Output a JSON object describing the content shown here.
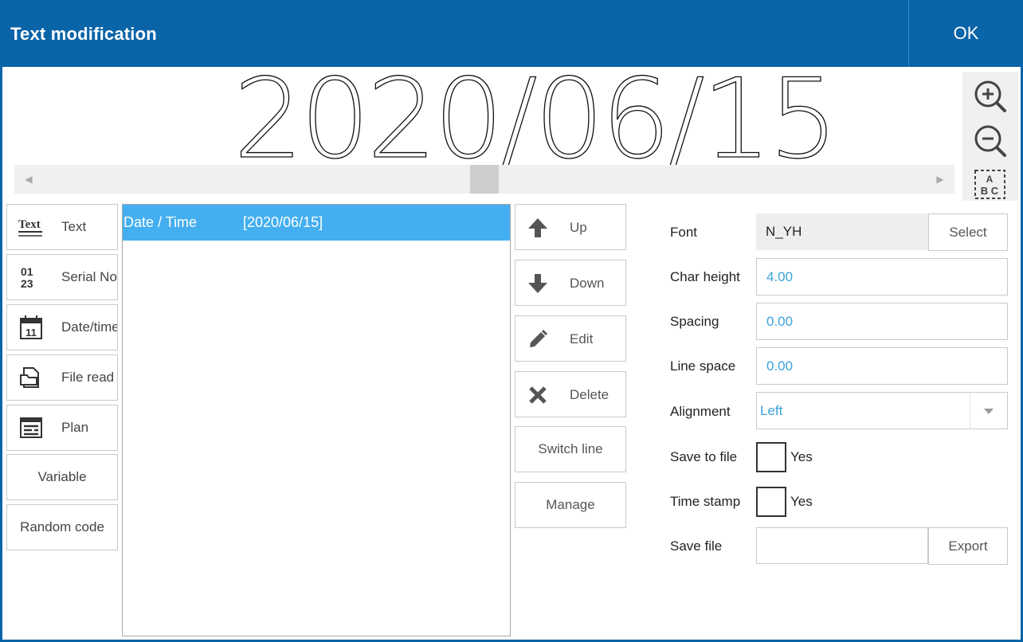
{
  "window": {
    "title": "Text modification",
    "ok_label": "OK"
  },
  "preview": {
    "text": "2020/06/15"
  },
  "zoom": {
    "zoom_in": "zoom-in-icon",
    "zoom_out": "zoom-out-icon",
    "fit": "abc-fit-icon",
    "fit_glyph_a": "A",
    "fit_glyph_bc": "B C"
  },
  "left_buttons": [
    {
      "label": "Text",
      "icon": "text-icon",
      "icon_text": "Text"
    },
    {
      "label": "Serial No.",
      "icon": "serial-icon",
      "icon_text_top": "01",
      "icon_text_bottom": "23"
    },
    {
      "label": "Date/time",
      "icon": "calendar-icon",
      "icon_text": "11"
    },
    {
      "label": "File read",
      "icon": "file-icon"
    },
    {
      "label": "Plan",
      "icon": "plan-icon"
    },
    {
      "label": "Variable"
    },
    {
      "label": "Random code"
    }
  ],
  "list": {
    "items": [
      {
        "name": "Date / Time",
        "value": "[2020/06/15]"
      }
    ]
  },
  "actions": [
    {
      "label": "Up",
      "icon": "arrow-up-icon"
    },
    {
      "label": "Down",
      "icon": "arrow-down-icon"
    },
    {
      "label": "Edit",
      "icon": "pencil-icon"
    },
    {
      "label": "Delete",
      "icon": "x-icon"
    },
    {
      "label": "Switch line"
    },
    {
      "label": "Manage"
    }
  ],
  "properties": {
    "font": {
      "label": "Font",
      "value": "N_YH",
      "button": "Select"
    },
    "char_height": {
      "label": "Char height",
      "value": "4.00"
    },
    "spacing": {
      "label": "Spacing",
      "value": "0.00"
    },
    "line_space": {
      "label": "Line space",
      "value": "0.00"
    },
    "alignment": {
      "label": "Alignment",
      "value": "Left"
    },
    "save_to_file": {
      "label": "Save to file",
      "option": "Yes",
      "checked": false
    },
    "time_stamp": {
      "label": "Time stamp",
      "option": "Yes",
      "checked": false
    },
    "save_file": {
      "label": "Save file",
      "value": "",
      "button": "Export"
    }
  },
  "colors": {
    "titlebar": "#0a64a8",
    "selection": "#43aef0",
    "value_text": "#3aa3dc"
  }
}
